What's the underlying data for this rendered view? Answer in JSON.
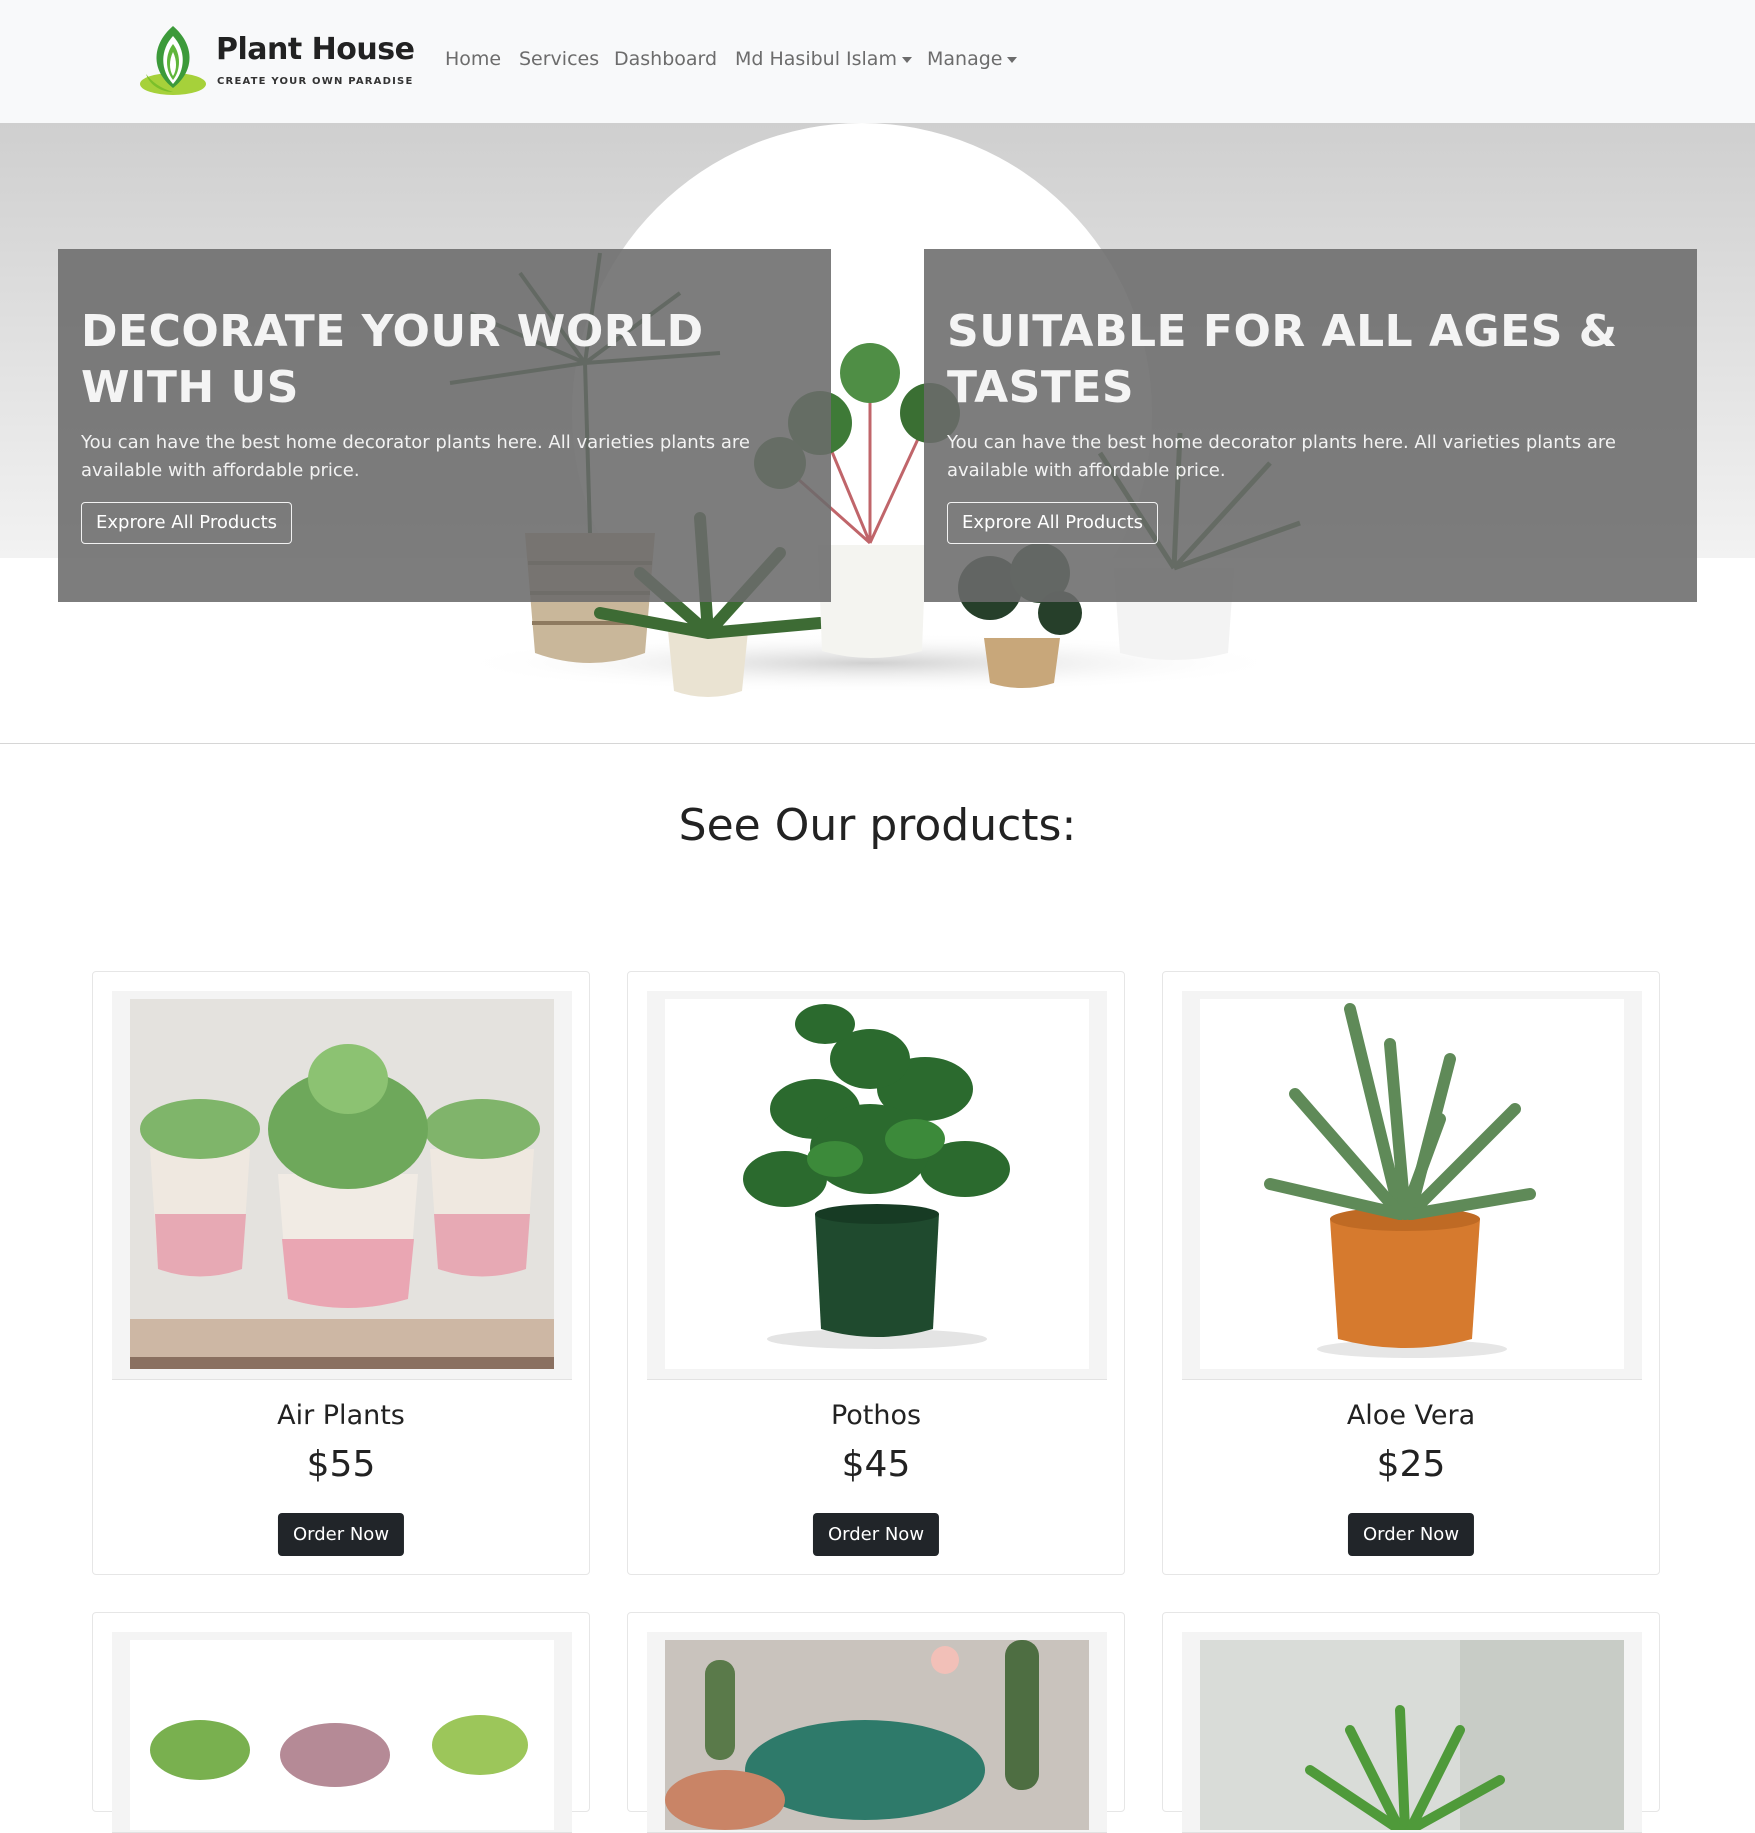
{
  "navbar": {
    "brand_name": "Plant House",
    "brand_tagline": "CREATE YOUR OWN PARADISE",
    "links": [
      {
        "label": "Home"
      },
      {
        "label": "Services"
      },
      {
        "label": "Dashboard"
      },
      {
        "label": "Md Hasibul Islam",
        "dropdown": true
      },
      {
        "label": "Manage",
        "dropdown": true
      }
    ]
  },
  "hero": {
    "slides": [
      {
        "title": "DECORATE YOUR WORLD WITH US",
        "text": "You can have the best home decorator plants here. All varieties plants are available with affordable price.",
        "button": "Exprore All Products"
      },
      {
        "title": "SUITABLE FOR ALL AGES & TASTES",
        "text": "You can have the best home decorator plants here. All varieties plants are available with affordable price.",
        "button": "Exprore All Products"
      }
    ]
  },
  "products": {
    "heading": "See Our products:",
    "order_label": "Order Now",
    "items": [
      {
        "name": "Air Plants",
        "price": "$55",
        "image": "succulents-pink-pots"
      },
      {
        "name": "Pothos",
        "price": "$45",
        "image": "pothos-green-pot"
      },
      {
        "name": "Aloe Vera",
        "price": "$25",
        "image": "aloe-orange-pot"
      },
      {
        "name": "",
        "price": "",
        "image": "succulents-small"
      },
      {
        "name": "",
        "price": "",
        "image": "cactus-collection"
      },
      {
        "name": "",
        "price": "",
        "image": "haworthia-succulent"
      }
    ]
  },
  "colors": {
    "navbar_bg": "#f8f9fa",
    "panel_overlay": "#6b6b6b",
    "button_dark": "#212529",
    "brand_green": "#7bbf2a"
  }
}
